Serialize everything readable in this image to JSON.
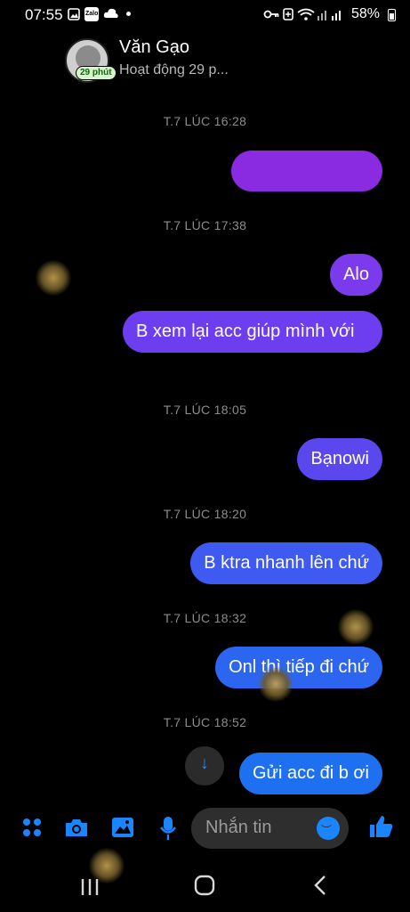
{
  "status_bar": {
    "time": "07:55",
    "battery": "58%",
    "zalo_label": "Zalo"
  },
  "header": {
    "name": "Văn Gạo",
    "status": "Hoạt động 29 p...",
    "active_badge": "29 phút"
  },
  "messages": [
    {
      "timestamp": "T.7 LÚC 16:28",
      "text": "",
      "color": "#8a2be2"
    },
    {
      "timestamp": "T.7 LÚC 17:38",
      "text": "Alo",
      "color": "#7c3aed"
    },
    {
      "timestamp": "",
      "text": "B xem lại acc giúp mình với",
      "color": "#6d3df0"
    },
    {
      "timestamp": "T.7 LÚC 18:05",
      "text": "Bạnowi",
      "color": "#5b47ee"
    },
    {
      "timestamp": "T.7 LÚC 18:20",
      "text": "B ktra nhanh lên chứ",
      "color": "#3f5af0"
    },
    {
      "timestamp": "T.7 LÚC 18:32",
      "text": "Onl thì tiếp đi chứ",
      "color": "#2c66f0"
    },
    {
      "timestamp": "T.7 LÚC 18:52",
      "text": "Gửi acc đi b ơi",
      "color": "#1e70f0"
    }
  ],
  "composer": {
    "placeholder": "Nhắn tin"
  },
  "colors": {
    "accent": "#1a85ff",
    "background": "#000000"
  }
}
